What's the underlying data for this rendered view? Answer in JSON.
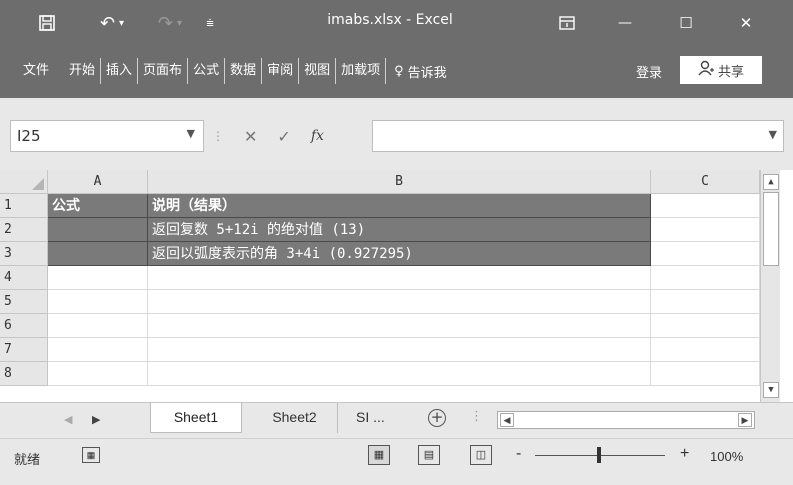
{
  "window": {
    "title": "imabs.xlsx - Excel",
    "controls": {
      "minimize": "—",
      "maximize": "☐",
      "close": "✕"
    }
  },
  "ribbon": {
    "tabs": [
      {
        "label": "文件"
      },
      {
        "label": "开始"
      },
      {
        "label": "插入"
      },
      {
        "label": "页面布"
      },
      {
        "label": "公式"
      },
      {
        "label": "数据"
      },
      {
        "label": "审阅"
      },
      {
        "label": "视图"
      },
      {
        "label": "加载项"
      }
    ],
    "tell_me": "告诉我",
    "login": "登录",
    "share": "共享"
  },
  "formula_bar": {
    "name_box": "I25",
    "cancel": "✕",
    "enter": "✓",
    "fx": "fx",
    "value": ""
  },
  "grid": {
    "columns": [
      {
        "label": "A"
      },
      {
        "label": "B"
      },
      {
        "label": "C"
      }
    ],
    "rows": [
      {
        "num": "1",
        "a": "公式",
        "b": "说明（结果）"
      },
      {
        "num": "2",
        "a": "",
        "b": "返回复数 5+12i 的绝对值 (13)"
      },
      {
        "num": "3",
        "a": "",
        "b": "返回以弧度表示的角 3+4i (0.927295)"
      },
      {
        "num": "4",
        "a": "",
        "b": ""
      },
      {
        "num": "5",
        "a": "",
        "b": ""
      },
      {
        "num": "6",
        "a": "",
        "b": ""
      },
      {
        "num": "7",
        "a": "",
        "b": ""
      },
      {
        "num": "8",
        "a": "",
        "b": ""
      }
    ]
  },
  "sheets": {
    "tabs": [
      {
        "label": "Sheet1"
      },
      {
        "label": "Sheet2"
      },
      {
        "label": "SI ..."
      }
    ],
    "add": "+"
  },
  "status": {
    "ready": "就绪",
    "zoom": "100%",
    "zoom_minus": "-",
    "zoom_plus": "+"
  }
}
